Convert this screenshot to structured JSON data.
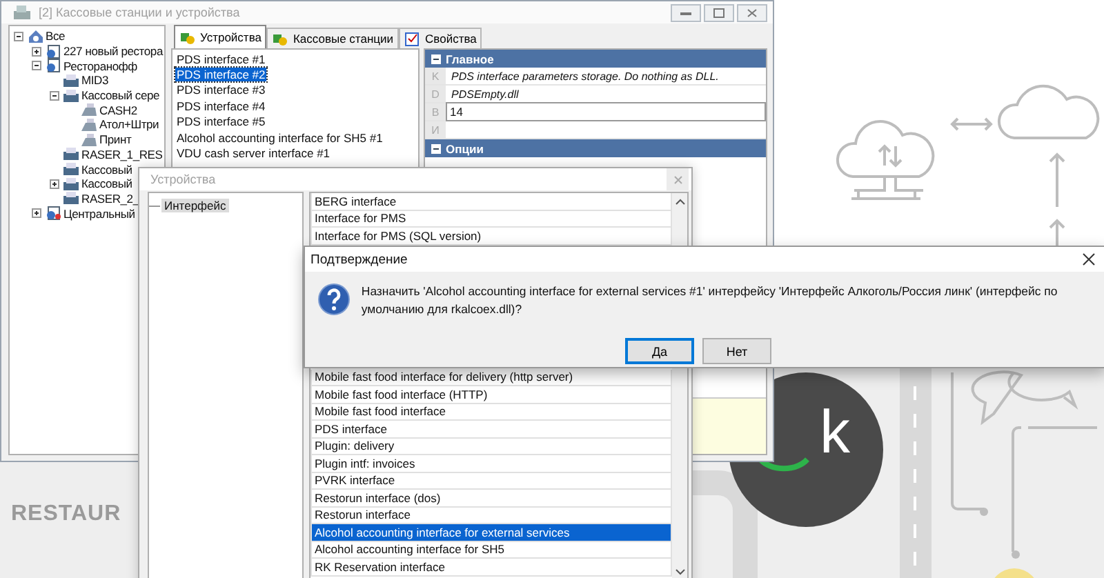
{
  "background": {
    "brand_text": "RESTAUR",
    "logo_text": "k"
  },
  "main_window": {
    "title": "[2] Кассовые станции и устройства",
    "tree": [
      {
        "label": "Все",
        "kind": "root",
        "expanded": true,
        "children": [
          {
            "label": "227 новый рестора",
            "kind": "restaurant",
            "expanded": false
          },
          {
            "label": "Ресторанофф",
            "kind": "restaurant",
            "expanded": true,
            "children": [
              {
                "label": "MID3",
                "kind": "server"
              },
              {
                "label": "Кассовый сере",
                "kind": "server",
                "expanded": true,
                "children": [
                  {
                    "label": "CASH2",
                    "kind": "terminal"
                  },
                  {
                    "label": "Атол+Штри",
                    "kind": "terminal"
                  },
                  {
                    "label": "Принт",
                    "kind": "terminal"
                  }
                ]
              },
              {
                "label": "RASER_1_RES",
                "kind": "server"
              },
              {
                "label": "Кассовый",
                "kind": "server"
              },
              {
                "label": "Кассовый",
                "kind": "server",
                "expanded": false
              },
              {
                "label": "RASER_2_",
                "kind": "server"
              }
            ]
          },
          {
            "label": "Центральный",
            "kind": "central",
            "expanded": false
          }
        ]
      }
    ],
    "tabs": [
      {
        "label": "Устройства",
        "selected": true
      },
      {
        "label": "Кассовые станции",
        "selected": false
      },
      {
        "label": "Свойства",
        "selected": false
      }
    ],
    "devices": [
      {
        "label": "PDS interface #1",
        "selected": false
      },
      {
        "label": "PDS interface #2",
        "selected": true
      },
      {
        "label": "PDS interface #3",
        "selected": false
      },
      {
        "label": "PDS interface #4",
        "selected": false
      },
      {
        "label": "PDS interface #5",
        "selected": false
      },
      {
        "label": "Alcohol accounting interface for SH5 #1",
        "selected": false
      },
      {
        "label": "VDU cash server interface #1",
        "selected": false
      }
    ],
    "properties": [
      {
        "kind": "header",
        "label": "Главное"
      },
      {
        "kind": "row",
        "label": "K",
        "value": "PDS interface parameters storage. Do nothing as DLL."
      },
      {
        "kind": "row",
        "label": "D",
        "value": "PDSEmpty.dll"
      },
      {
        "kind": "edit",
        "label": "B",
        "value": "14"
      },
      {
        "kind": "row",
        "label": "И"
      },
      {
        "kind": "header",
        "label": "Опции"
      }
    ]
  },
  "devices_dialog": {
    "title": "Устройства",
    "tree": [
      {
        "label": "Интерфейс",
        "selected": true
      }
    ],
    "interfaces_upper": [
      {
        "label": "BERG interface",
        "selected": false
      },
      {
        "label": "Interface for PMS",
        "selected": false
      },
      {
        "label": "Interface for PMS (SQL version)",
        "selected": false
      }
    ],
    "interfaces_lower": [
      {
        "label": "Mobile fast food interface for delivery (http server)",
        "selected": false
      },
      {
        "label": "Mobile fast food interface (HTTP)",
        "selected": false
      },
      {
        "label": "Mobile fast food interface",
        "selected": false
      },
      {
        "label": "PDS interface",
        "selected": false
      },
      {
        "label": "Plugin: delivery",
        "selected": false
      },
      {
        "label": "Plugin intf: invoices",
        "selected": false
      },
      {
        "label": "PVRK interface",
        "selected": false
      },
      {
        "label": "Restorun interface (dos)",
        "selected": false
      },
      {
        "label": "Restorun interface",
        "selected": false
      },
      {
        "label": "Alcohol accounting interface for external services",
        "selected": true
      },
      {
        "label": "Alcohol accounting interface for SH5",
        "selected": false
      },
      {
        "label": "RK Reservation interface",
        "selected": false
      }
    ]
  },
  "confirm_dialog": {
    "title": "Подтверждение",
    "message": "Назначить 'Alcohol accounting interface for external services #1' интерфейсу 'Интерфейс Алкоголь/Россия линк' (интерфейс по умолчанию для rkalcoex.dll)?",
    "buttons": [
      {
        "label": "Да",
        "focused": true
      },
      {
        "label": "Нет",
        "focused": false
      }
    ]
  }
}
